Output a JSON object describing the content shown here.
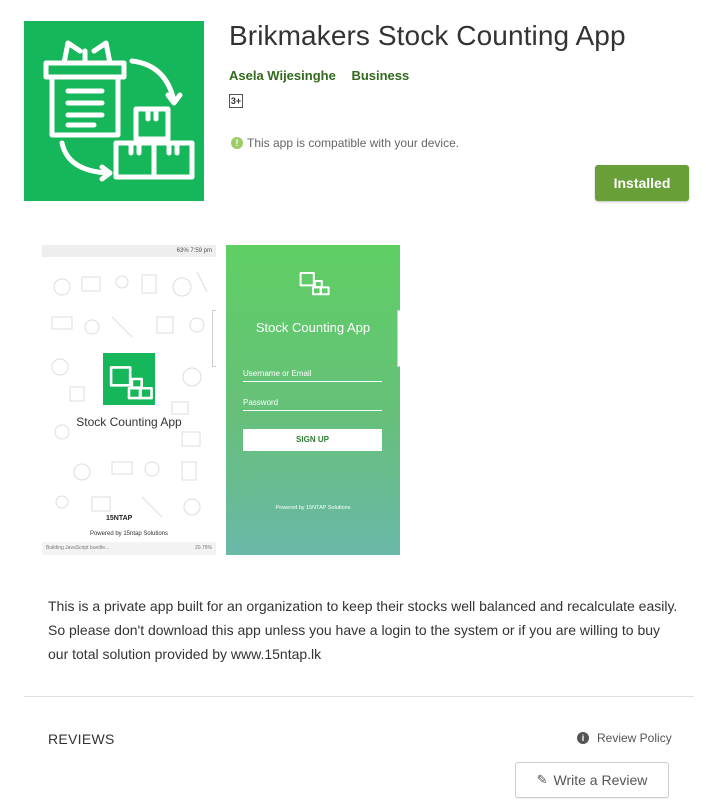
{
  "app": {
    "title": "Brikmakers Stock Counting App",
    "developer": "Asela Wijesinghe",
    "category": "Business",
    "content_rating": "3+",
    "compatibility": "This app is compatible with your device.",
    "install_button": "Installed",
    "icon": "app-logo-icon",
    "brand_color": "#16b65a",
    "accent_color": "#689f38"
  },
  "screenshots": {
    "splash": {
      "status_left": "",
      "status_right": "63% 7:59 pm",
      "title": "Stock Counting App",
      "brand": "15NTAP",
      "powered": "Powered by 15ntap Solutions",
      "building": "Building JavaScript bundle...",
      "progress": "20.76%"
    },
    "login": {
      "title": "Stock Counting App",
      "username_placeholder": "Username or Email",
      "password_placeholder": "Password",
      "signup": "SIGN UP",
      "powered": "Powered by 15NTAP Solutions"
    }
  },
  "description": {
    "line1": "This is a private app built for an organization to keep their stocks well balanced and recalculate easily.",
    "line2": "So please don't download this app unless you have a login to the system or if you are willing to buy",
    "line3": "our total solution provided by www.15ntap.lk"
  },
  "reviews": {
    "heading": "REVIEWS",
    "policy_link": "Review Policy",
    "write_button": "Write a Review"
  }
}
